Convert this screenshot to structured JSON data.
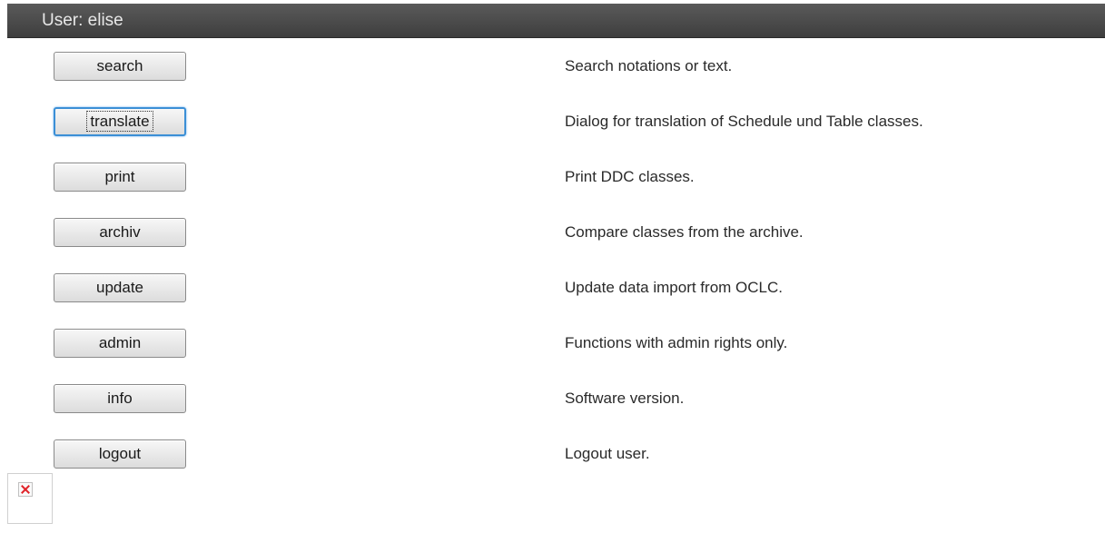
{
  "header": {
    "user_label": "User: elise"
  },
  "menu": [
    {
      "button": "search",
      "description": "Search notations or text.",
      "focused": false
    },
    {
      "button": "translate",
      "description": "Dialog for translation of Schedule und Table classes.",
      "focused": true
    },
    {
      "button": "print",
      "description": "Print DDC classes.",
      "focused": false
    },
    {
      "button": "archiv",
      "description": "Compare classes from the archive.",
      "focused": false
    },
    {
      "button": "update",
      "description": "Update data import from OCLC.",
      "focused": false
    },
    {
      "button": "admin",
      "description": "Functions with admin rights only.",
      "focused": false
    },
    {
      "button": "info",
      "description": "Software version.",
      "focused": false
    },
    {
      "button": "logout",
      "description": "Logout user.",
      "focused": false
    }
  ],
  "footer": {
    "broken_image_icon": "broken-image-icon"
  },
  "colors": {
    "header_bg": "#474747",
    "header_text": "#e8e8e8",
    "focus_ring": "#3b8fd6",
    "broken_x": "#e0242a"
  }
}
